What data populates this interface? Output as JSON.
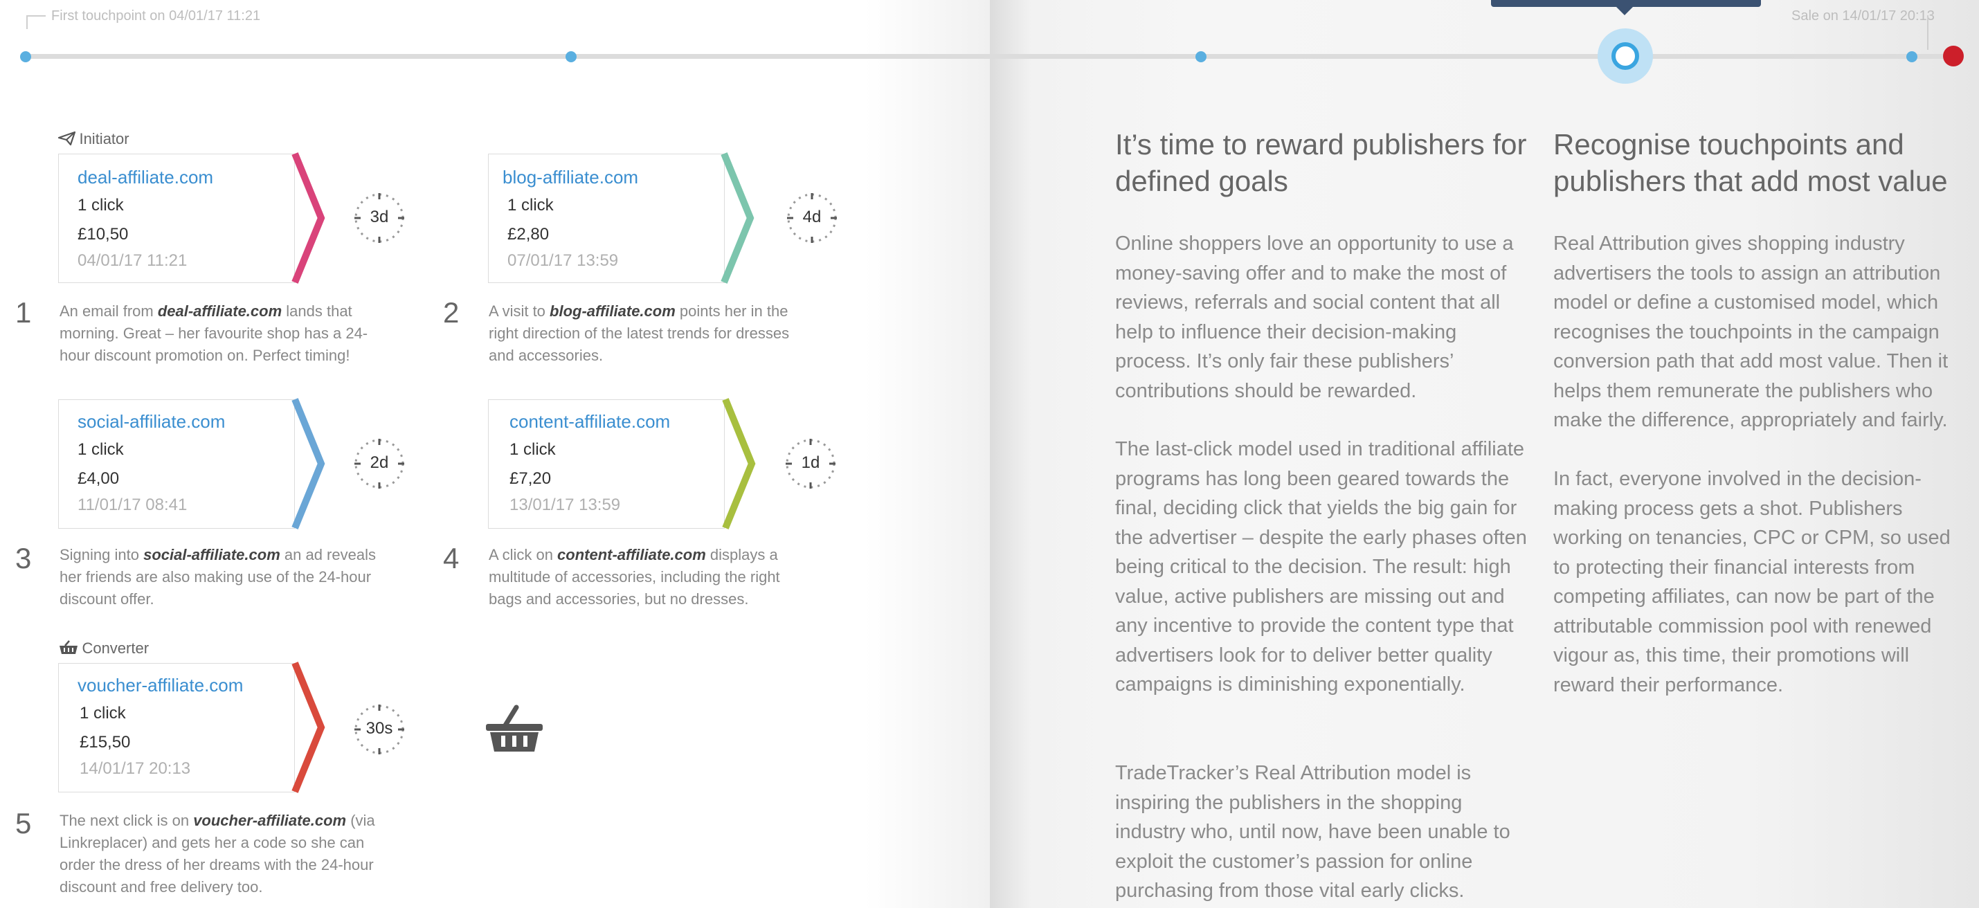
{
  "timeline": {
    "first_touchpoint_label": "First touchpoint on 04/01/17 11:21",
    "sale_label": "Sale on 14/01/17 20:13"
  },
  "touchpoints": [
    {
      "domain": "deal-affiliate.com",
      "clicks": "1 click",
      "amount": "£10,50",
      "date": "04/01/17 11:21",
      "wait": "3d",
      "step": "1",
      "color": "#d9437a",
      "desc_before": "An email from ",
      "desc_domain": "deal-affiliate.com",
      "desc_after": " lands that morning. Great – her favourite shop has a 24-hour discount promotion on. Perfect timing!"
    },
    {
      "domain": "blog-affiliate.com",
      "clicks": "1 click",
      "amount": "£2,80",
      "date": "07/01/17 13:59",
      "wait": "4d",
      "step": "2",
      "color": "#7cc5ad",
      "desc_before": "A visit to ",
      "desc_domain": "blog-affiliate.com",
      "desc_after": " points her in the right direction of the latest trends for dresses and accessories."
    },
    {
      "domain": "social-affiliate.com",
      "clicks": "1 click",
      "amount": "£4,00",
      "date": "11/01/17 08:41",
      "wait": "2d",
      "step": "3",
      "color": "#6aa6d6",
      "desc_before": "Signing into ",
      "desc_domain": "social-affiliate.com",
      "desc_after": " an ad reveals her friends are also making use of the 24-hour discount offer."
    },
    {
      "domain": "content-affiliate.com",
      "clicks": "1 click",
      "amount": "£7,20",
      "date": "13/01/17 13:59",
      "wait": "1d",
      "step": "4",
      "color": "#a8bf3f",
      "desc_before": "A click on ",
      "desc_domain": "content-affiliate.com",
      "desc_after": " displays a multitude of accessories, including the right bags and accessories, but no dresses."
    },
    {
      "domain": "voucher-affiliate.com",
      "clicks": "1 click",
      "amount": "£15,50",
      "date": "14/01/17 20:13",
      "wait": "30s",
      "step": "5",
      "color": "#d94a3c",
      "desc_before": "The next click is on ",
      "desc_domain": "voucher-affiliate.com",
      "desc_after": " (via Linkreplacer) and gets her a code so she can order the dress of her dreams with the 24-hour discount and free delivery too."
    }
  ],
  "roles": {
    "initiator": "Initiator",
    "converter": "Converter"
  },
  "icons": {
    "initiator": "paper-plane-icon",
    "converter": "basket-icon",
    "basket_large": "basket-icon"
  },
  "colors": {
    "accent_blue": "#5aafe0",
    "sale_red": "#cc1f2a",
    "tooltip_navy": "#3b5272"
  },
  "article": {
    "col1": {
      "heading": "It’s time to reward publishers for defined goals",
      "paragraphs": [
        "Online shoppers love an opportunity to use a money-saving offer and to make the most of reviews, referrals and social content that all help to influence their decision-making process. It’s only fair these publishers’ contributions should be rewarded.",
        "The last-click model used in traditional affiliate programs has long been geared towards the final, deciding click that yields the big gain for the advertiser – despite the early phases often being critical to the decision. The result: high value, active publishers are missing out and any incentive to provide the content type that advertisers look for to deliver better quality campaigns is diminishing exponentially.",
        "TradeTracker’s Real Attribution model is inspiring the publishers in the shopping industry who, until now, have been unable to exploit the customer’s passion for online purchasing from those vital early clicks."
      ]
    },
    "col2": {
      "heading": "Recognise touchpoints and publishers that add most value",
      "paragraphs": [
        "Real Attribution gives shopping industry advertisers the tools to assign an attribution model or define a customised model, which recognises the touchpoints in the campaign conversion path that add most value. Then it helps them remunerate the publishers who make the difference, appropriately and fairly.",
        "In fact, everyone involved in the decision-making process gets a shot. Publishers working on tenancies, CPC or CPM, so used to protecting their financial interests from competing affiliates, can now be part of the attributable commission pool with renewed vigour as, this time, their promotions will reward their performance."
      ]
    }
  }
}
